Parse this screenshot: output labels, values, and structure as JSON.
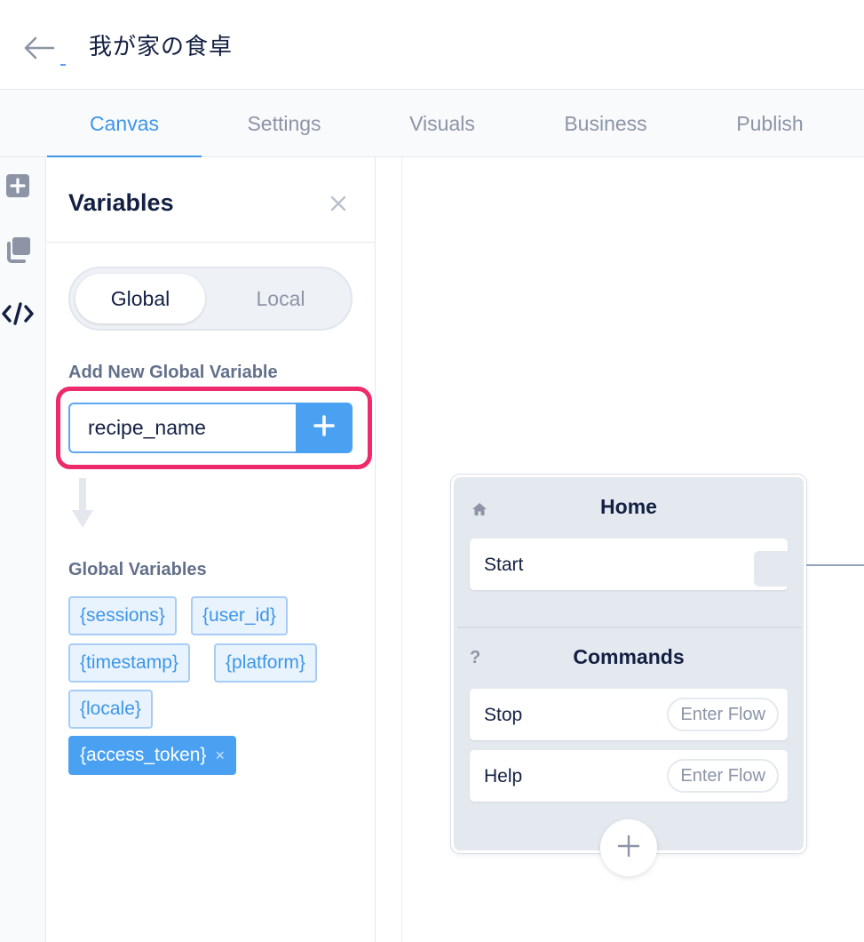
{
  "header": {
    "back_icon": "arrow-left-icon",
    "title": "我が家の食卓"
  },
  "tabs": [
    {
      "label": "Canvas",
      "active": true
    },
    {
      "label": "Settings",
      "active": false
    },
    {
      "label": "Visuals",
      "active": false
    },
    {
      "label": "Business",
      "active": false
    },
    {
      "label": "Publish",
      "active": false
    }
  ],
  "rail": {
    "icons": [
      "add-block-icon",
      "copy-icon",
      "code-icon"
    ]
  },
  "variables_panel": {
    "title": "Variables",
    "close_icon": "close-icon",
    "scope_toggle": {
      "global": "Global",
      "local": "Local",
      "selected": "Global"
    },
    "add_label": "Add New Global Variable",
    "input_value": "recipe_name",
    "add_button_icon": "plus-icon",
    "list_label": "Global Variables",
    "variables": [
      {
        "name": "{sessions}",
        "selected": false
      },
      {
        "name": "{user_id}",
        "selected": false
      },
      {
        "name": "{timestamp}",
        "selected": false
      },
      {
        "name": "{platform}",
        "selected": false
      },
      {
        "name": "{locale}",
        "selected": false
      },
      {
        "name": "{access_token}",
        "selected": true,
        "remove_icon": "×"
      }
    ]
  },
  "canvas": {
    "block": {
      "home_icon": "home-icon",
      "title": "Home",
      "start_label": "Start",
      "commands_icon": "?",
      "commands_title": "Commands",
      "commands": [
        {
          "label": "Stop",
          "action": "Enter Flow"
        },
        {
          "label": "Help",
          "action": "Enter Flow"
        }
      ],
      "add_icon": "plus-icon"
    }
  },
  "colors": {
    "accent": "#3d96e8",
    "highlight": "#ee2a6a",
    "chip_bg": "#e9f3fe",
    "chip_selected": "#4aa1f2"
  }
}
